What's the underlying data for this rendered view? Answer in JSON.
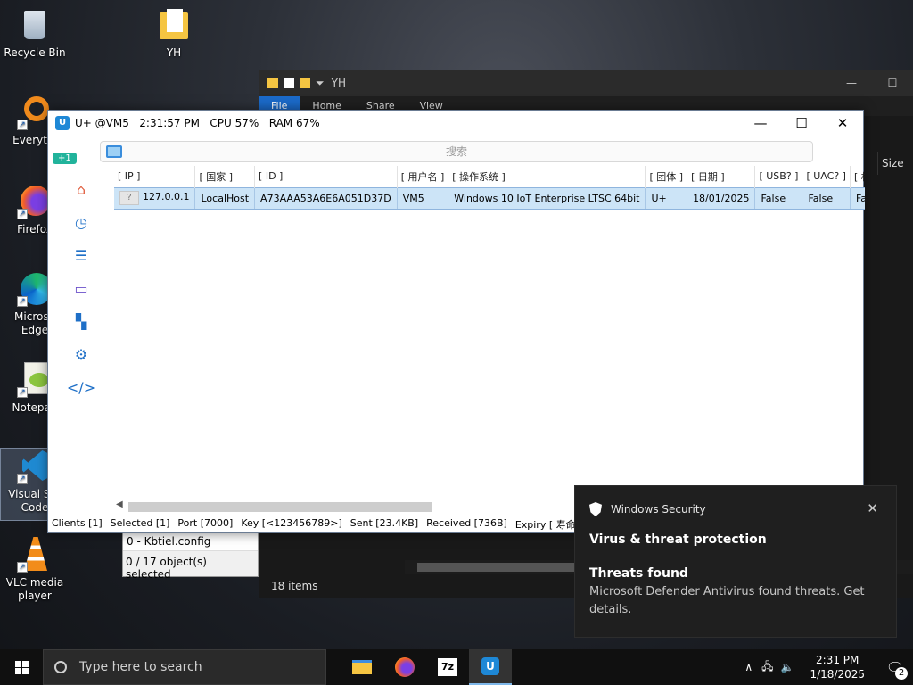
{
  "desktop": {
    "icons": [
      {
        "label": "Recycle Bin"
      },
      {
        "label": "YH"
      },
      {
        "label": "Everythi"
      },
      {
        "label": "Firefox"
      },
      {
        "label": "Microso Edge"
      },
      {
        "label": "Notepad"
      },
      {
        "label": "Visual Stu Code"
      },
      {
        "label": "VLC media player"
      }
    ]
  },
  "explorer": {
    "title": "YH",
    "tabs": [
      "File",
      "Home",
      "Share",
      "View"
    ],
    "size_header": "Size",
    "status": "18 items",
    "left_status": "0 / 17 object(s) selected",
    "left_row": "0 - Kbtiel.config"
  },
  "app": {
    "title": "U+ @VM5   2:31:57 PM   CPU 57%   RAM 67%",
    "search_placeholder": "搜索",
    "badge": "+1",
    "columns": [
      "[ IP ]",
      "[ 国家 ]",
      "[ ID ]",
      "[ 用户名 ]",
      "[ 操作系统 ]",
      "[ 团体 ]",
      "[ 日期 ]",
      "[ USB? ]",
      "[ UAC? ]",
      "[ 相机? ]"
    ],
    "rows": [
      [
        "127.0.0.1",
        "LocalHost",
        "A73AAA53A6E6A051D37D",
        "VM5",
        "Windows 10 IoT Enterprise LTSC 64bit",
        "U+",
        "18/01/2025",
        "False",
        "False",
        "False"
      ]
    ],
    "status": {
      "clients": "Clients [1]",
      "selected": "Selected [1]",
      "port": "Port [7000]",
      "key": "Key [<123456789>]",
      "sent": "Sent [23.4KB]",
      "received": "Received [736B]",
      "expiry": "Expiry [ 寿命 ]"
    }
  },
  "toast": {
    "app": "Windows Security",
    "heading": "Virus & threat protection",
    "subheading": "Threats found",
    "body": "Microsoft Defender Antivirus found threats. Get details."
  },
  "taskbar": {
    "search_placeholder": "Type here to search",
    "time": "2:31 PM",
    "date": "1/18/2025",
    "notifications": "2"
  }
}
